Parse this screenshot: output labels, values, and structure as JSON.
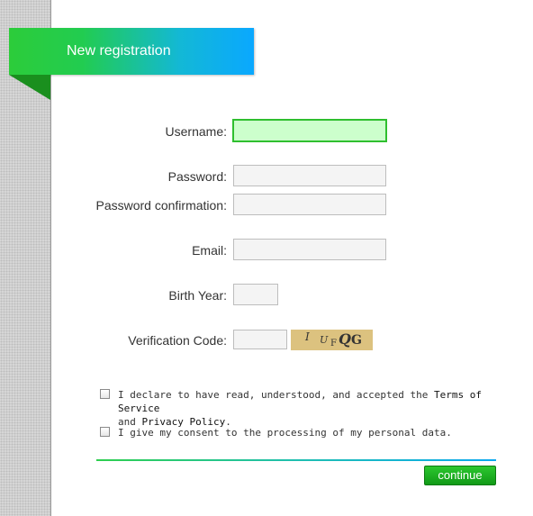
{
  "header": {
    "title": "New registration"
  },
  "form": {
    "username": {
      "label": "Username:",
      "value": ""
    },
    "password": {
      "label": "Password:",
      "value": ""
    },
    "password_confirmation": {
      "label": "Password confirmation:",
      "value": ""
    },
    "email": {
      "label": "Email:",
      "value": ""
    },
    "birth_year": {
      "label": "Birth Year:",
      "value": ""
    },
    "verification_code": {
      "label": "Verification Code:",
      "value": "",
      "captcha_chars": [
        "I",
        "U",
        "F",
        "Q",
        "G"
      ]
    }
  },
  "consents": {
    "terms": {
      "text_before": "I declare to have read, understood, and accepted the ",
      "terms_link": "Terms of Service",
      "and_text": "and ",
      "privacy_link": "Privacy Policy",
      "period": ".",
      "checked": false
    },
    "data_processing": {
      "text": "I give my consent to the processing of my personal data.",
      "checked": false
    }
  },
  "actions": {
    "continue_label": "continue"
  },
  "colors": {
    "accent_green": "#22c52f",
    "accent_blue": "#0aa8ff",
    "focus_bg": "#ccffcc"
  }
}
